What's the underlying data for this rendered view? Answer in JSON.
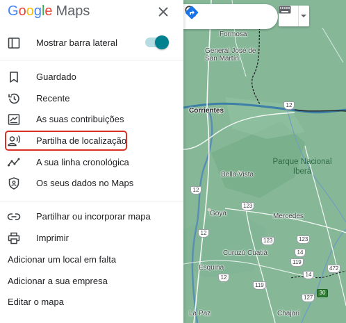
{
  "logo": {
    "letters": [
      "G",
      "o",
      "o",
      "g",
      "l",
      "e"
    ],
    "product": "Maps"
  },
  "menu": {
    "toggle_item": {
      "label": "Mostrar barra lateral",
      "icon": "sidebar-icon",
      "enabled": true
    },
    "personal_items": [
      {
        "label": "Guardado",
        "icon": "bookmark-icon"
      },
      {
        "label": "Recente",
        "icon": "history-icon"
      },
      {
        "label": "As suas contribuições",
        "icon": "contributions-icon"
      },
      {
        "label": "Partilha de localização",
        "icon": "location-sharing-icon",
        "highlighted": true
      },
      {
        "label": "A sua linha cronológica",
        "icon": "timeline-icon"
      },
      {
        "label": "Os seus dados no Maps",
        "icon": "shield-data-icon"
      }
    ],
    "action_items": [
      {
        "label": "Partilhar ou incorporar mapa",
        "icon": "link-icon"
      },
      {
        "label": "Imprimir",
        "icon": "printer-icon"
      }
    ],
    "text_items": [
      "Adicionar um local em falta",
      "Adicionar a sua empresa",
      "Editar o mapa"
    ]
  },
  "map": {
    "places": [
      "Formosa",
      "General José de San Martín",
      "Corrientes",
      "Bella Vista",
      "Parque Nacional Iberá",
      "Goya",
      "Mercedes",
      "Curuzú Cuatiá",
      "Esquina",
      "La Paz",
      "Chajarí"
    ],
    "route_shields": [
      "12",
      "12",
      "12",
      "123",
      "123",
      "123",
      "12",
      "119",
      "119",
      "127",
      "14",
      "472",
      "14",
      "30"
    ]
  },
  "colors": {
    "accent": "#00818f",
    "highlight_border": "#d93025",
    "map_land": "#86b898",
    "map_river": "#3d7fa8"
  }
}
